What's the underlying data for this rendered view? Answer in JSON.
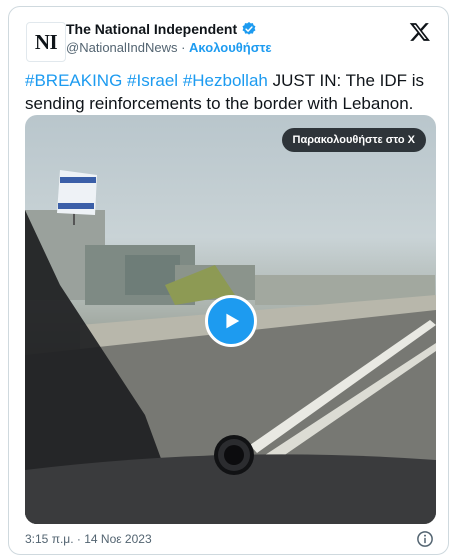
{
  "author": {
    "avatar_text": "NI",
    "name": "The National Independent",
    "handle": "@NationalIndNews",
    "separator": " · ",
    "follow_label": "Ακολουθήστε",
    "verified_icon": "verified-badge-icon"
  },
  "tweet": {
    "hashtags": [
      "#BREAKING",
      "#Israel",
      "#Hezbollah"
    ],
    "text": " JUST IN: The IDF is sending reinforcements to the border with Lebanon."
  },
  "media": {
    "watch_label": "Παρακολουθήστε στο X",
    "play_icon": "play-icon"
  },
  "footer": {
    "timestamp": "3:15 π.μ. · 14 Νοε 2023",
    "info_icon": "info-icon"
  },
  "colors": {
    "accent": "#1d9bf0",
    "text": "#0f1419",
    "secondary": "#536471",
    "border": "#cfd9de"
  }
}
